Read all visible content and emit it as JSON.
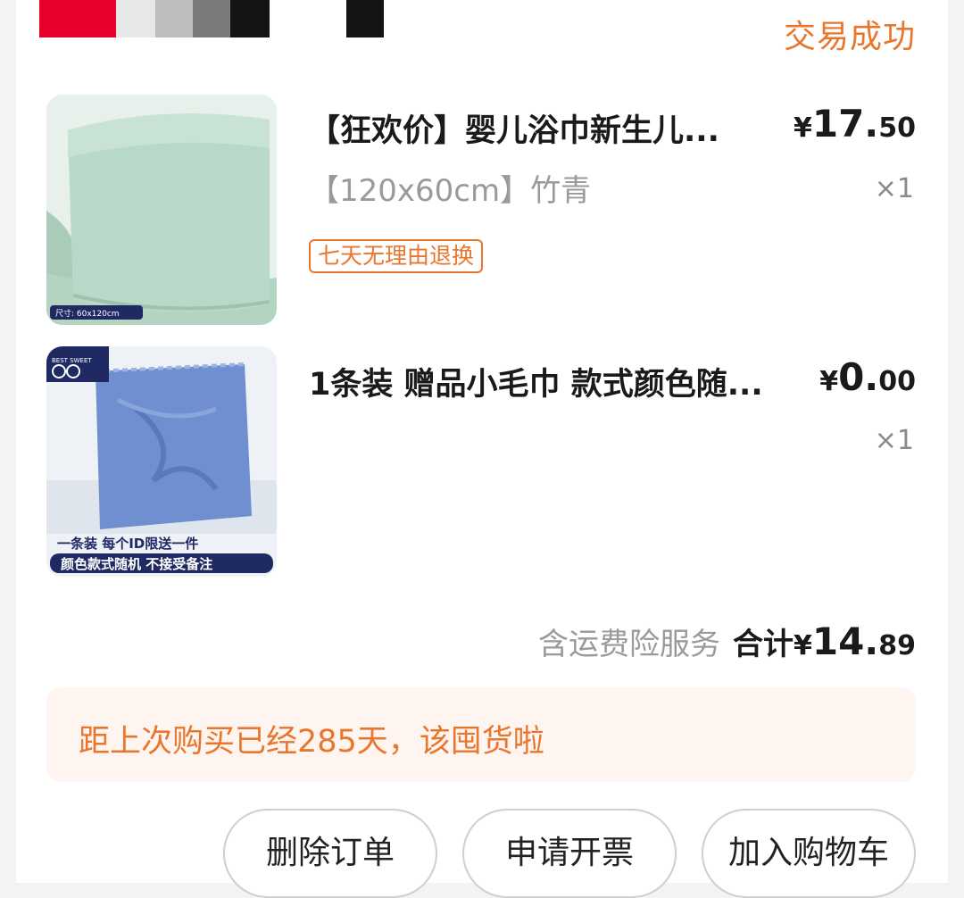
{
  "order": {
    "status": "交易成功"
  },
  "items": [
    {
      "title": "【狂欢价】婴儿浴巾新生儿...",
      "sku": "【120x60cm】竹青",
      "tag": "七天无理由退换",
      "price_currency": "¥",
      "price_int": "17.",
      "price_dec": "50",
      "qty": "×1",
      "image_caption": "尺寸: 60x120cm"
    },
    {
      "title": "1条装 赠品小毛巾 款式颜色随...",
      "price_currency": "¥",
      "price_int": "0.",
      "price_dec": "00",
      "qty": "×1",
      "image_logo": "BEST SWEET",
      "image_line1": "一条装  每个ID限送一件",
      "image_line2": "颜色款式随机  不接受备注"
    }
  ],
  "summary": {
    "service": "含运费险服务",
    "total_label": "合计",
    "total_currency": "¥",
    "total_int": "14.",
    "total_dec": "89"
  },
  "banner": {
    "text": "距上次购买已经285天，该囤货啦"
  },
  "actions": {
    "delete": "删除订单",
    "invoice": "申请开票",
    "add_cart": "加入购物车"
  },
  "colors": {
    "accent": "#e8762d",
    "towel_green": "#b9d9c8",
    "towel_blue": "#6f8fd0",
    "badge_navy": "#1f2a63"
  }
}
